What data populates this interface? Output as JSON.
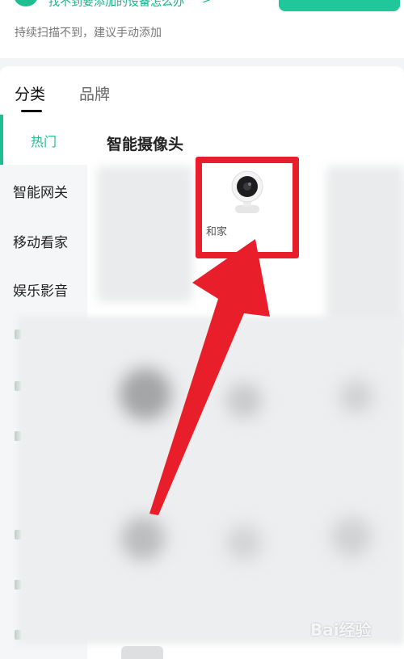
{
  "header": {
    "help_link": "找不到要添加的设备怎么办",
    "help_chevron": ">",
    "hint": "持续扫描不到，建议手动添加"
  },
  "tabs": [
    {
      "label": "分类",
      "active": true
    },
    {
      "label": "品牌",
      "active": false
    }
  ],
  "sidebar": {
    "items": [
      {
        "label": "热门",
        "active": true
      },
      {
        "label": "智能网关",
        "active": false
      },
      {
        "label": "移动看家",
        "active": false
      },
      {
        "label": "娱乐影音",
        "active": false
      }
    ]
  },
  "section": {
    "title": "智能摄像头"
  },
  "products": [
    {
      "name": "和家",
      "icon": "camera-icon",
      "highlighted": true
    }
  ],
  "annotation": {
    "box_color": "#e81f2a",
    "arrow_color": "#e81f2a"
  },
  "watermark": {
    "text": "Bai经验"
  },
  "colors": {
    "accent": "#1dbf90",
    "background": "#f3f4f5"
  }
}
